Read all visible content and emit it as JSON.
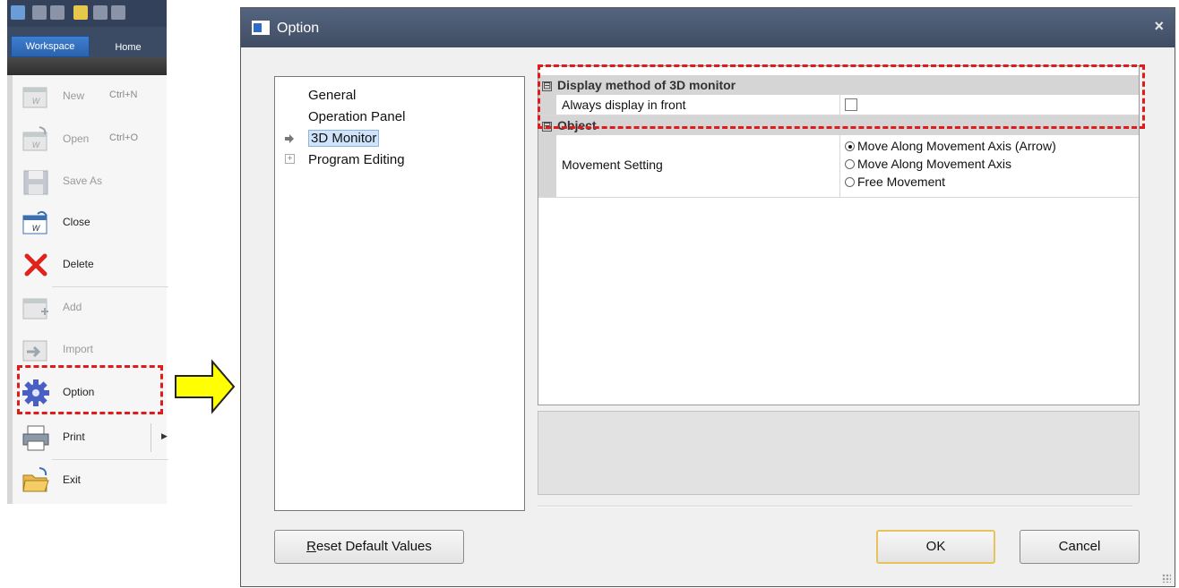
{
  "left_menu": {
    "tabs": {
      "workspace": "Workspace",
      "home": "Home"
    },
    "items": [
      {
        "label": "New",
        "shortcut": "Ctrl+N",
        "icon": "new-file-icon",
        "disabled": true
      },
      {
        "label": "Open",
        "shortcut": "Ctrl+O",
        "icon": "open-file-icon",
        "disabled": true
      },
      {
        "label": "Save As",
        "icon": "save-icon",
        "disabled": true
      },
      {
        "label": "Close",
        "icon": "close-workspace-icon",
        "disabled": false
      },
      {
        "label": "Delete",
        "icon": "delete-x-icon",
        "disabled": false
      },
      {
        "label": "Add",
        "icon": "add-icon",
        "disabled": true
      },
      {
        "label": "Import",
        "icon": "import-icon",
        "disabled": true
      },
      {
        "label": "Option",
        "icon": "gear-icon",
        "disabled": false
      },
      {
        "label": "Print",
        "icon": "printer-icon",
        "disabled": false
      },
      {
        "label": "Exit",
        "icon": "folder-exit-icon",
        "disabled": false
      }
    ]
  },
  "dialog": {
    "title": "Option",
    "close_glyph": "×",
    "tree": {
      "items": [
        "General",
        "Operation Panel",
        "3D Monitor",
        "Program Editing"
      ],
      "selected": "3D Monitor",
      "expander_glyph": "+"
    },
    "property_grid": {
      "categories": [
        {
          "title": "Display method of 3D monitor",
          "toggle": "⊟",
          "properties": [
            {
              "name": "Always display in front",
              "value": false
            }
          ]
        },
        {
          "title": "Object",
          "toggle": "⊟",
          "properties": [
            {
              "name": "Movement Setting",
              "options": [
                "Move Along Movement Axis (Arrow)",
                "Move Along Movement Axis",
                "Free Movement"
              ],
              "selected_index": 0
            }
          ]
        }
      ]
    },
    "buttons": {
      "reset_prefix": "R",
      "reset_rest": "eset Default Values",
      "ok": "OK",
      "cancel": "Cancel"
    }
  },
  "colors": {
    "highlight_dash": "#e01b1b",
    "arrow_fill": "#ffff00",
    "titlebar": "#4a586f",
    "workspace_tab": "#2f6cba"
  }
}
